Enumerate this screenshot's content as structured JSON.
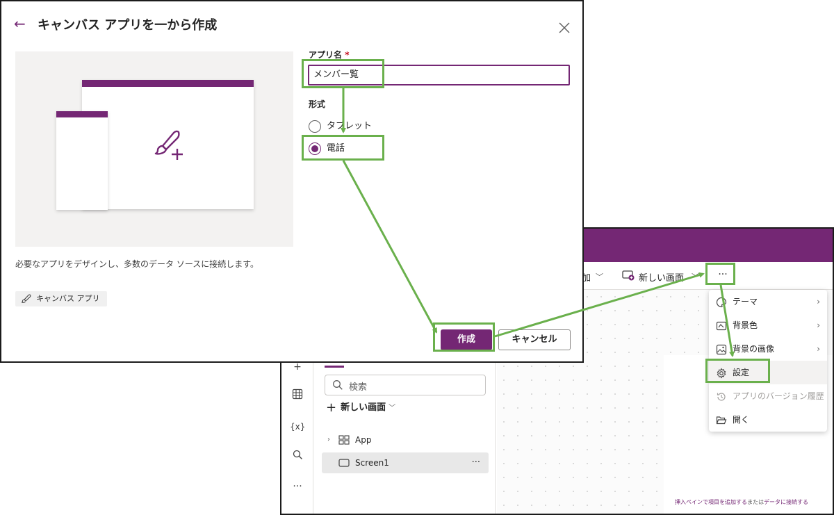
{
  "dialog": {
    "title": "キャンバス アプリを一から作成",
    "description": "必要なアプリをデザインし、多数のデータ ソースに接続します。",
    "tag_label": "キャンバス アプリ",
    "app_name_label": "アプリ名",
    "required_mark": "*",
    "app_name_value": "メンバー覧",
    "format_label": "形式",
    "format_options": [
      {
        "label": "タブレット",
        "selected": false
      },
      {
        "label": "電話",
        "selected": true
      }
    ],
    "create_label": "作成",
    "cancel_label": "キャンセル"
  },
  "studio": {
    "command_bar": {
      "insert_label_partial": "加",
      "new_screen_label": "新しい画面",
      "more_label": "···"
    },
    "tree": {
      "search_placeholder": "検索",
      "new_screen_label": "新しい画面",
      "items": [
        {
          "label": "App",
          "icon": "app-icon"
        },
        {
          "label": "Screen1",
          "icon": "screen-icon",
          "selected": true,
          "more": "···"
        }
      ]
    },
    "left_rail_icons": [
      "add-icon",
      "table-icon",
      "variables-icon",
      "search-icon",
      "more-icon"
    ],
    "rail_variables_text": "{x}",
    "rail_more_text": "···",
    "canvas_hint_parts": [
      "挿入ペインで項目を追加する",
      "または",
      "データに接続する"
    ],
    "menu": [
      {
        "label": "テーマ",
        "icon": "theme-icon",
        "submenu": true
      },
      {
        "label": "背景色",
        "icon": "background-color-icon",
        "submenu": true
      },
      {
        "label": "背景の画像",
        "icon": "background-image-icon",
        "submenu": true
      },
      {
        "label": "設定",
        "icon": "gear-icon",
        "submenu": false
      },
      {
        "label": "アプリのバージョン履歴",
        "icon": "history-icon",
        "submenu": false,
        "disabled": true
      },
      {
        "label": "開く",
        "icon": "folder-icon",
        "submenu": false
      }
    ]
  },
  "colors": {
    "brand_purple": "#742774",
    "annotation_green": "#6ab04c"
  }
}
